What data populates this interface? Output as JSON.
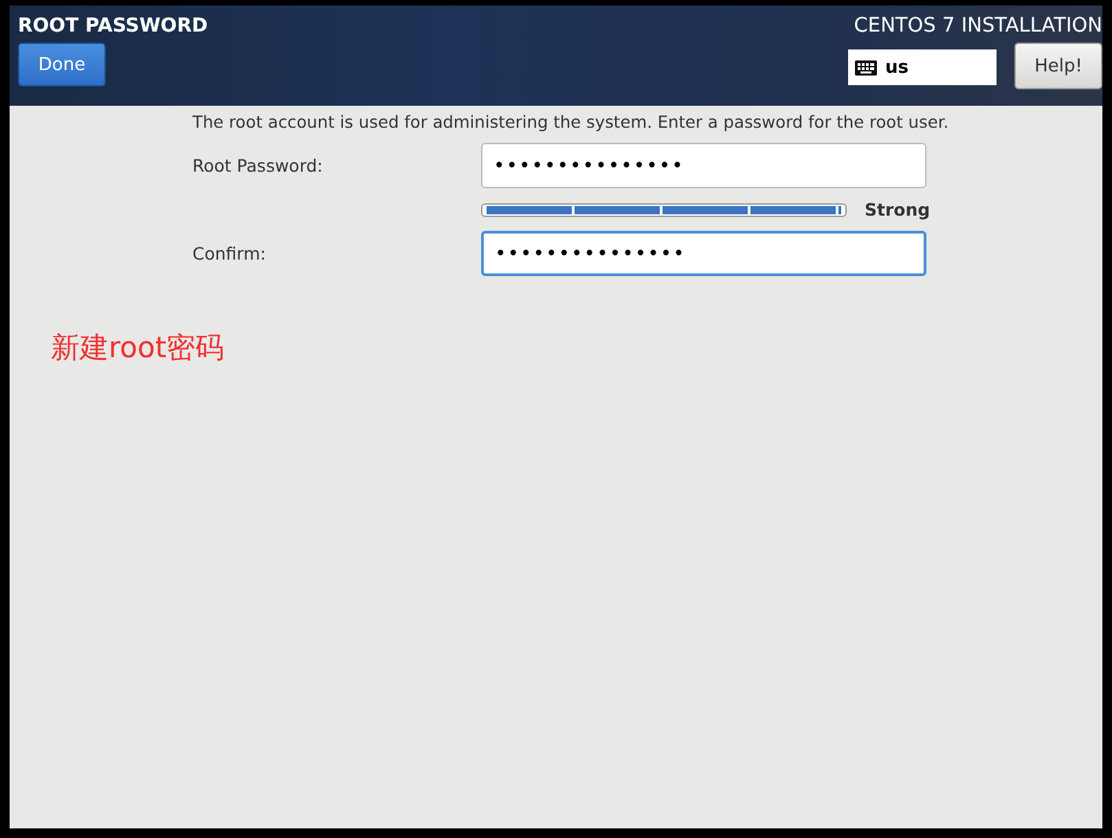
{
  "header": {
    "title": "ROOT PASSWORD",
    "done_button": "Done",
    "product": "CENTOS 7 INSTALLATION",
    "keyboard_layout": "us",
    "help_button": "Help!"
  },
  "intro": "The root account is used for administering the system.  Enter a password for the root user.",
  "fields": [
    {
      "kind": "password",
      "label": "Root Password:",
      "value": "•••••••••••••••",
      "focused": false
    },
    {
      "kind": "meter",
      "level": 1,
      "reading": "Strong"
    },
    {
      "kind": "password",
      "label": "Confirm:",
      "value": "•••••••••••••••",
      "focused": true
    }
  ],
  "annotation": "新建root密码"
}
